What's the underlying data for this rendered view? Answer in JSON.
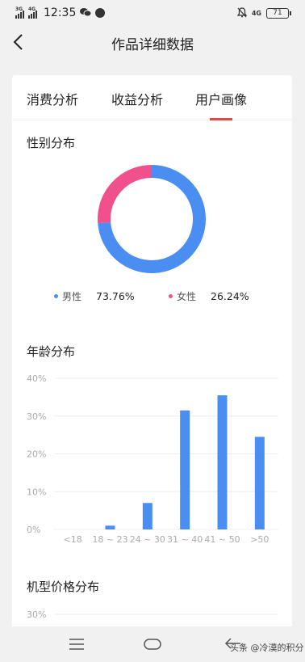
{
  "status_bar": {
    "time": "12:35",
    "signal1": "3G",
    "signal2": "4G",
    "network": "4G",
    "battery": "71"
  },
  "header": {
    "title": "作品详细数据"
  },
  "tabs": [
    {
      "label": "消费分析",
      "active": false
    },
    {
      "label": "收益分析",
      "active": false
    },
    {
      "label": "用户画像",
      "active": true
    }
  ],
  "gender": {
    "title": "性别分布",
    "items": [
      {
        "label": "男性",
        "value": "73.76%",
        "color": "#4b8ef1"
      },
      {
        "label": "女性",
        "value": "26.24%",
        "color": "#f0508c"
      }
    ]
  },
  "age": {
    "title": "年龄分布"
  },
  "price": {
    "title": "机型价格分布",
    "first_tick": "30%"
  },
  "chart_data": [
    {
      "type": "pie",
      "title": "性别分布",
      "categories": [
        "男性",
        "女性"
      ],
      "values": [
        73.76,
        26.24
      ],
      "colors": [
        "#4b8ef1",
        "#f0508c"
      ]
    },
    {
      "type": "bar",
      "title": "年龄分布",
      "categories": [
        "<18",
        "18 ~ 23",
        "24 ~ 30",
        "31 ~ 40",
        "41 ~ 50",
        ">50"
      ],
      "values": [
        0,
        1,
        7,
        31.5,
        35.5,
        24.5
      ],
      "ylim": [
        0,
        40
      ],
      "yticks": [
        "0%",
        "10%",
        "20%",
        "30%",
        "40%"
      ],
      "color": "#4b8ef1",
      "grid": true
    }
  ],
  "bottom_nav": {
    "watermark": "头条 @冷漠的积分"
  }
}
